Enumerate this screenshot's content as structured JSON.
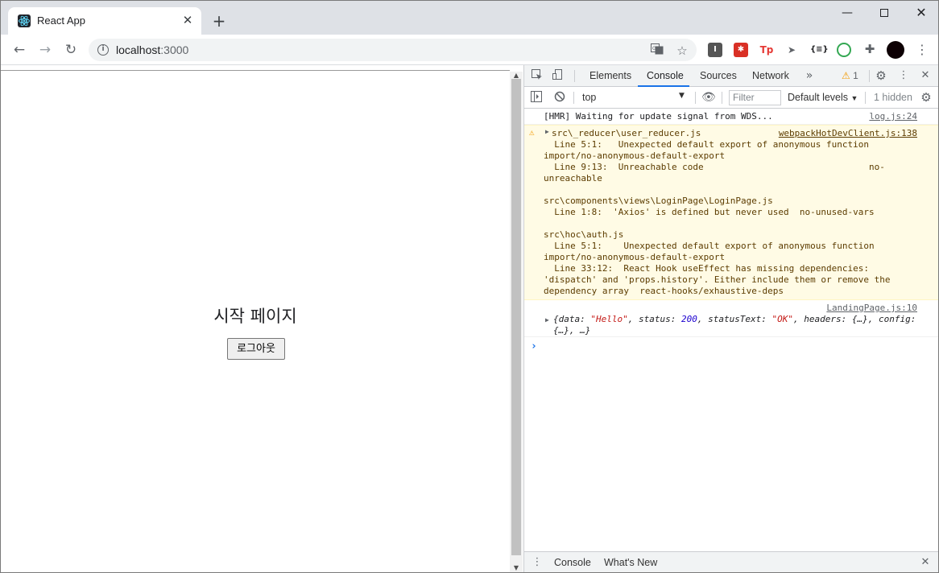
{
  "browser": {
    "tab_title": "React App",
    "url_host": "localhost",
    "url_port": ":3000"
  },
  "page": {
    "title": "시작 페이지",
    "logout_label": "로그아웃"
  },
  "devtools": {
    "tabs": [
      "Elements",
      "Console",
      "Sources",
      "Network"
    ],
    "warning_count": "1",
    "context": "top",
    "filter_placeholder": "Filter",
    "levels": "Default levels",
    "hidden": "1 hidden",
    "messages": [
      {
        "text": "[HMR] Waiting for update signal from WDS...",
        "source": "log.js:24"
      },
      {
        "text": "src\\_reducer\\user_reducer.js\n  Line 5:1:   Unexpected default export of anonymous function\nimport/no-anonymous-default-export\n  Line 9:13:  Unreachable code                               no-\nunreachable\n\nsrc\\components\\views\\LoginPage\\LoginPage.js\n  Line 1:8:  'Axios' is defined but never used  no-unused-vars\n\nsrc\\hoc\\auth.js\n  Line 5:1:    Unexpected default export of anonymous function\nimport/no-anonymous-default-export\n  Line 33:12:  React Hook useEffect has missing dependencies:\n'dispatch' and 'props.history'. Either include them or remove the\ndependency array  react-hooks/exhaustive-deps",
        "source": "webpackHotDevClient.js:138"
      },
      {
        "source": "LandingPage.js:10",
        "obj_prefix": "{data: ",
        "obj_data": "\"Hello\"",
        "obj_mid1": ", status: ",
        "obj_status": "200",
        "obj_mid2": ", statusText: ",
        "obj_status_text": "\"OK\"",
        "obj_suffix": ", headers: {…}, config:",
        "obj_line2": "{…}, …}"
      }
    ],
    "drawer_tabs": [
      "Console",
      "What's New"
    ]
  },
  "colors": {
    "accent": "#1a73e8",
    "warning": "#f29900",
    "warning_bg": "#fffbe5"
  }
}
